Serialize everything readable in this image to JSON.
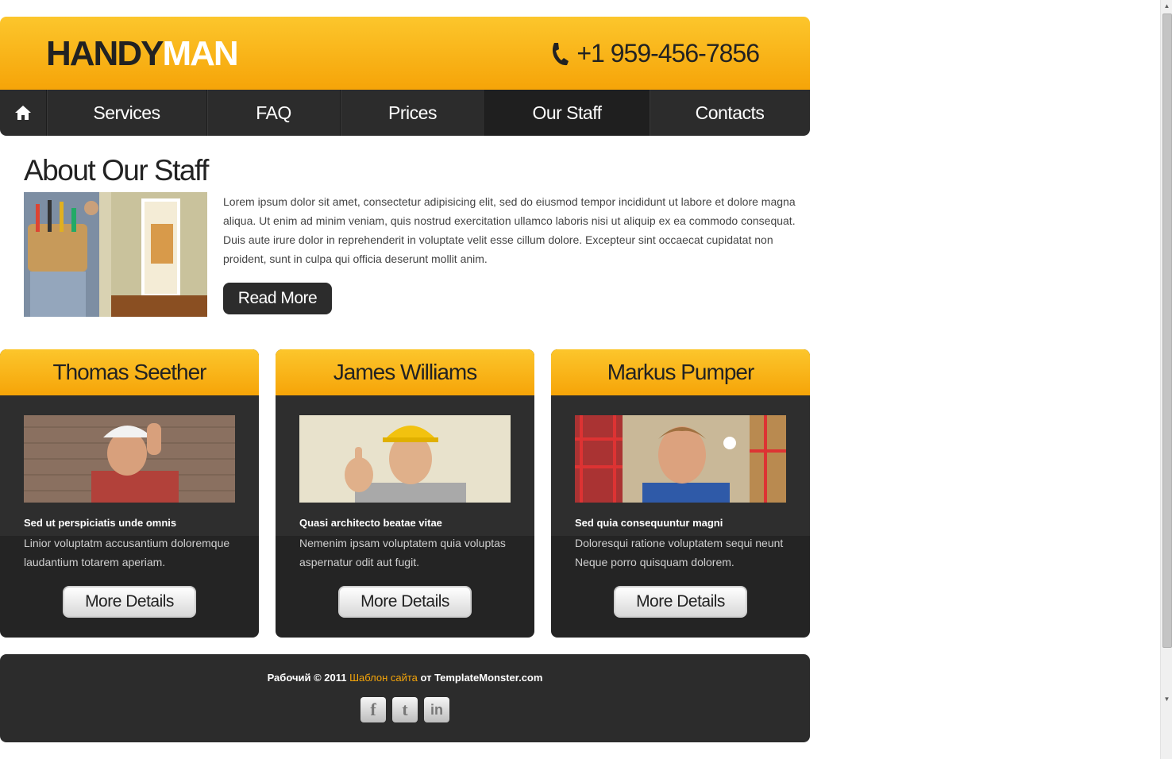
{
  "header": {
    "logo_part1": "HANDY",
    "logo_part2": "MAN",
    "phone": "+1 959-456-7856",
    "phone_icon": "phone-icon"
  },
  "nav": {
    "home_icon": "home-icon",
    "items": [
      {
        "label": "Services"
      },
      {
        "label": "FAQ"
      },
      {
        "label": "Prices"
      },
      {
        "label": "Our Staff"
      },
      {
        "label": "Contacts"
      }
    ],
    "active": "Our Staff"
  },
  "about": {
    "title": "About Our Staff",
    "text": "Lorem ipsum dolor sit amet, consectetur adipisicing elit, sed do eiusmod tempor incididunt ut labore et dolore magna aliqua. Ut enim ad minim veniam, quis nostrud exercitation ullamco laboris nisi ut aliquip ex ea commodo consequat. Duis aute irure dolor in reprehenderit in voluptate velit esse cillum dolore. Excepteur sint occaecat cupidatat non proident, sunt in culpa qui officia deserunt mollit anim.",
    "read_more": "Read More"
  },
  "staff": [
    {
      "name": "Thomas Seether",
      "subtitle": "Sed ut perspiciatis unde omnis",
      "text": "Linior voluptatm accusantium doloremque laudantium totarem aperiam.",
      "button": "More Details"
    },
    {
      "name": "James Williams",
      "subtitle": "Quasi architecto beatae vitae",
      "text": "Nemenim ipsam voluptatem quia voluptas aspernatur odit aut fugit.",
      "button": "More Details"
    },
    {
      "name": "Markus Pumper",
      "subtitle": "Sed quia consequuntur magni",
      "text": "Doloresqui ratione voluptatem sequi neunt Neque porro quisquam dolorem.",
      "button": "More Details"
    }
  ],
  "footer": {
    "prefix": "Рабочий © 2011",
    "link": "Шаблон сайта",
    "suffix": "от TemplateMonster.com",
    "socials": [
      {
        "icon": "facebook-icon",
        "glyph": "f"
      },
      {
        "icon": "twitter-icon",
        "glyph": "t"
      },
      {
        "icon": "linkedin-icon",
        "glyph": "in"
      }
    ]
  },
  "colors": {
    "accent_top": "#fcc62c",
    "accent_bottom": "#f6a408",
    "dark": "#2c2c2c",
    "link": "#f5a50a"
  }
}
